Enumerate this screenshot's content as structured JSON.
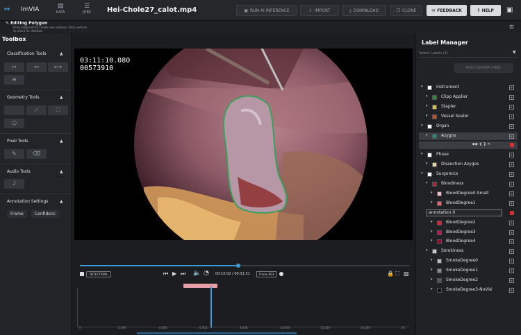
{
  "app": {
    "logo": "↦",
    "name": "ImVIA"
  },
  "nav": [
    {
      "icon": "▤",
      "label": "DATA"
    },
    {
      "icon": "☰",
      "label": "JOBS"
    }
  ],
  "file_title": "Hei-Chole27_calot.mp4",
  "toolbar": {
    "run_ai": "RUN AI INFERENCE",
    "import": "IMPORT",
    "download": "DOWNLOAD",
    "clone": "CLONE",
    "feedback": "FEEDBACK",
    "help": "HELP"
  },
  "editing": {
    "title": "Editing Polygon",
    "hint": "Drag midpoints to create new vertices. Click vertices to select for deletion."
  },
  "toolbox": {
    "title": "Toolbox",
    "sections": {
      "classification": "Classification Tools",
      "geometry": "Geometry Tools",
      "pixel": "Pixel Tools",
      "audio": "Audio Tools",
      "annotation": "Annotation Settings"
    },
    "annotation_options": [
      "Frame",
      "Confidenc"
    ]
  },
  "video": {
    "timecode": "03:11:10.080",
    "frame_number": "00573910",
    "detections_label": "DETECTIONS",
    "time_current": "00:10:02",
    "time_total": "00:31:51",
    "frame_label": "Frame 603",
    "progress": 0.48
  },
  "timeline": {
    "ticks": [
      "0",
      "2,000",
      "4,000",
      "6,000",
      "8,000",
      "10,000",
      "12,000",
      "14,000",
      "16,"
    ]
  },
  "label_manager": {
    "title": "Label Manager",
    "select_placeholder": "Select Labels (1)",
    "add_custom": "ADD CUSTOM LABEL",
    "labels": [
      {
        "name": "Instrument",
        "color": "#ffffff",
        "level": 0
      },
      {
        "name": "Clipp Applier",
        "color": "#2e8b3a",
        "level": 1
      },
      {
        "name": "Stapler",
        "color": "#e0c040",
        "level": 1
      },
      {
        "name": "Vessel Sealer",
        "color": "#c84a1a",
        "level": 1
      },
      {
        "name": "Organ",
        "color": "#ffffff",
        "level": 0
      },
      {
        "name": "Azygos",
        "color": "#1e8a7a",
        "level": 1,
        "selected": true
      },
      {
        "name": "",
        "color": "",
        "level": 2,
        "controls": true
      },
      {
        "name": "Phase",
        "color": "#ffffff",
        "level": 0
      },
      {
        "name": "Dissection Azygos",
        "color": "#e8d8a0",
        "level": 1
      },
      {
        "name": "Surgomics",
        "color": "#ffffff",
        "level": 0
      },
      {
        "name": "Bloodiness",
        "color": "#b02030",
        "level": 1
      },
      {
        "name": "BloodDegree0-Small",
        "color": "#f0c0c8",
        "level": 2
      },
      {
        "name": "BloodDegree1",
        "color": "#e86a7a",
        "level": 2
      },
      {
        "name": "annotation 0",
        "color": "",
        "level": 2,
        "instance": true
      },
      {
        "name": "BloodDegree2",
        "color": "#d02a3a",
        "level": 2
      },
      {
        "name": "BloodDegree3",
        "color": "#b01a4a",
        "level": 2
      },
      {
        "name": "BloodDegree4",
        "color": "#8a1030",
        "level": 2
      },
      {
        "name": "Smokiness",
        "color": "#cccccc",
        "level": 1
      },
      {
        "name": "SmokeDegree0",
        "color": "#bbbbbb",
        "level": 2
      },
      {
        "name": "SmokeDegree1",
        "color": "#888888",
        "level": 2
      },
      {
        "name": "SmokeDegree2",
        "color": "#555555",
        "level": 2
      },
      {
        "name": "SmokeDegree3-NoVisi",
        "color": "#111111",
        "level": 2
      }
    ]
  }
}
